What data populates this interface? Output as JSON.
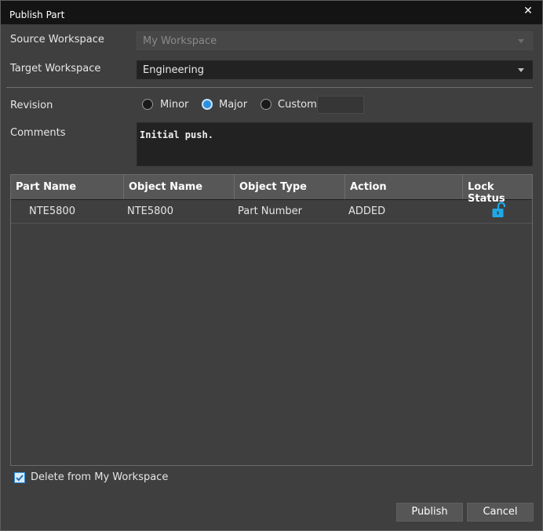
{
  "window": {
    "title": "Publish Part",
    "close_glyph": "✕"
  },
  "form": {
    "source_workspace": {
      "label": "Source Workspace",
      "value": "My Workspace"
    },
    "target_workspace": {
      "label": "Target Workspace",
      "value": "Engineering"
    },
    "revision": {
      "label": "Revision",
      "options": [
        "Minor",
        "Major",
        "Custom"
      ],
      "selected": "Major",
      "custom_value": ""
    },
    "comments": {
      "label": "Comments",
      "value": "Initial push."
    }
  },
  "grid": {
    "columns": [
      "Part Name",
      "Object Name",
      "Object Type",
      "Action",
      "Lock Status"
    ],
    "rows": [
      {
        "part_name": "NTE5800",
        "object_name": "NTE5800",
        "object_type": "Part Number",
        "action": "ADDED",
        "lock_status_icon": "unlocked-icon"
      }
    ]
  },
  "footer": {
    "delete_checkbox": {
      "label": "Delete from My Workspace",
      "checked": true
    },
    "publish_label": "Publish",
    "cancel_label": "Cancel"
  },
  "colors": {
    "accent": "#2b8fe0",
    "lock_icon": "#1fa8e8",
    "background": "#3f3f3f",
    "titlebar": "#141414"
  }
}
